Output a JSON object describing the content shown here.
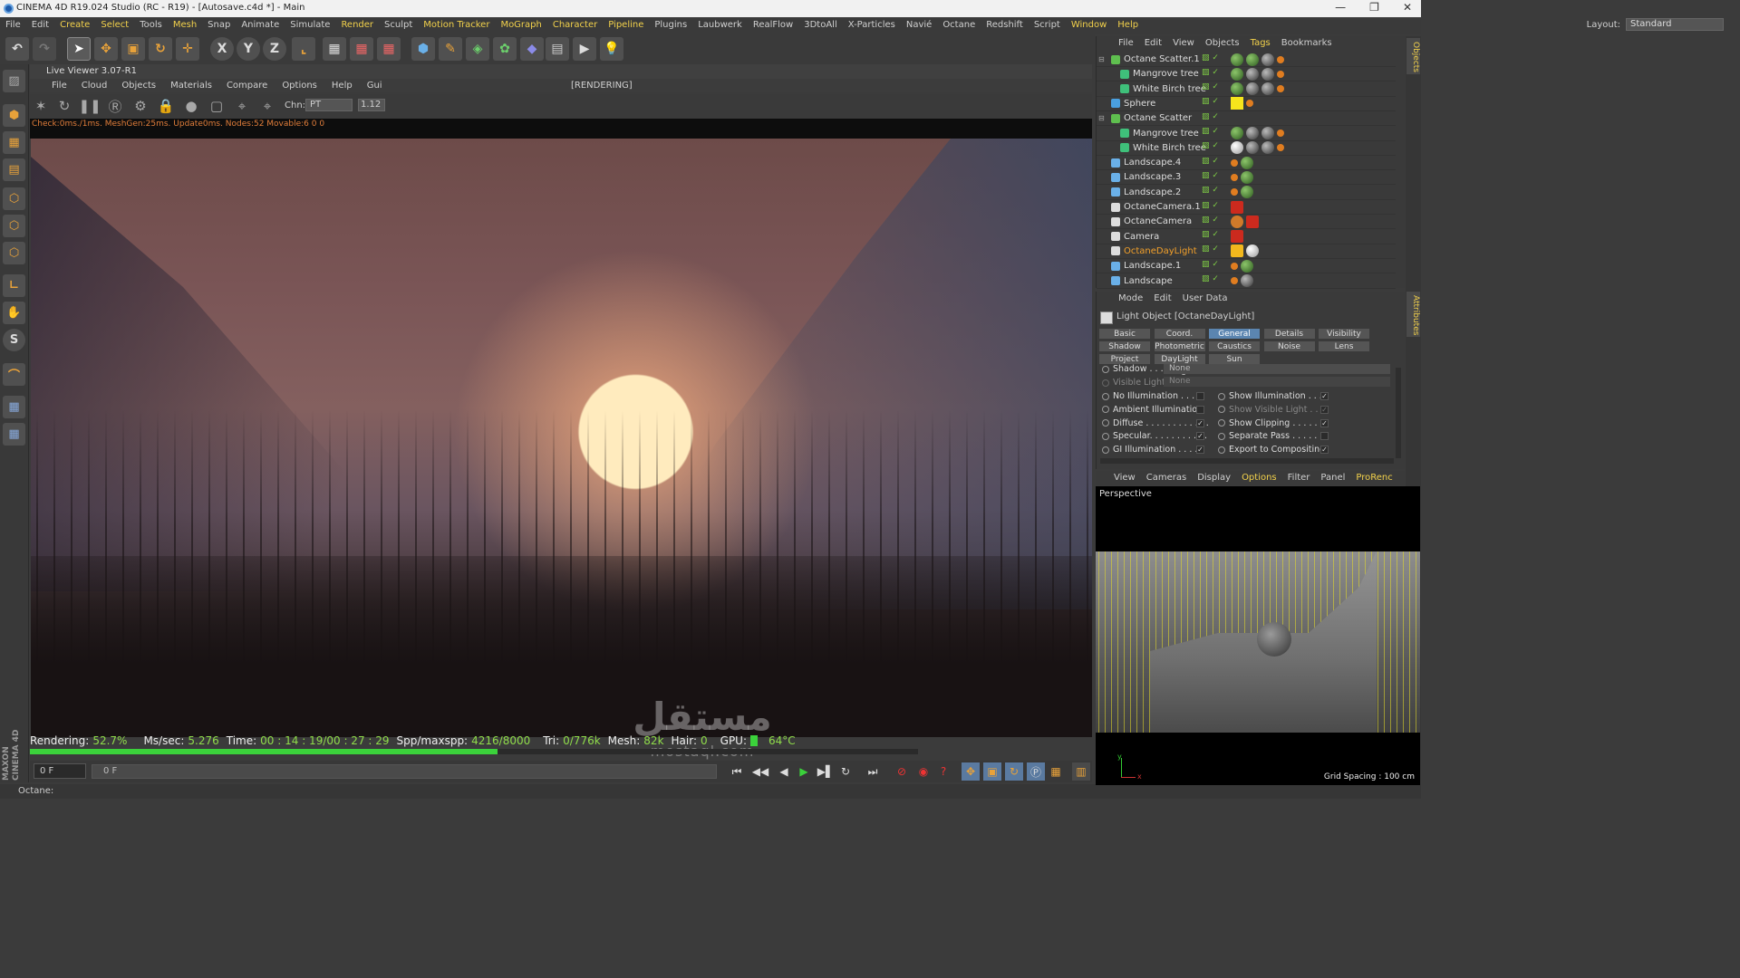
{
  "window": {
    "title": "CINEMA 4D R19.024 Studio (RC - R19) - [Autosave.c4d *] - Main",
    "controls": [
      "—",
      "❐",
      "✕"
    ]
  },
  "menubar": {
    "items": [
      {
        "label": "File",
        "hl": false
      },
      {
        "label": "Edit",
        "hl": false
      },
      {
        "label": "Create",
        "hl": true
      },
      {
        "label": "Select",
        "hl": true
      },
      {
        "label": "Tools",
        "hl": false
      },
      {
        "label": "Mesh",
        "hl": true
      },
      {
        "label": "Snap",
        "hl": false
      },
      {
        "label": "Animate",
        "hl": false
      },
      {
        "label": "Simulate",
        "hl": false
      },
      {
        "label": "Render",
        "hl": true
      },
      {
        "label": "Sculpt",
        "hl": false
      },
      {
        "label": "Motion Tracker",
        "hl": true
      },
      {
        "label": "MoGraph",
        "hl": true
      },
      {
        "label": "Character",
        "hl": true
      },
      {
        "label": "Pipeline",
        "hl": true
      },
      {
        "label": "Plugins",
        "hl": false
      },
      {
        "label": "Laubwerk",
        "hl": false
      },
      {
        "label": "RealFlow",
        "hl": false
      },
      {
        "label": "3DtoAll",
        "hl": false
      },
      {
        "label": "X-Particles",
        "hl": false
      },
      {
        "label": "Navié",
        "hl": false
      },
      {
        "label": "Octane",
        "hl": false
      },
      {
        "label": "Redshift",
        "hl": false
      },
      {
        "label": "Script",
        "hl": false
      },
      {
        "label": "Window",
        "hl": true
      },
      {
        "label": "Help",
        "hl": true
      }
    ],
    "layout_label": "Layout:",
    "layout_value": "Standard"
  },
  "toolbar": {
    "icons": [
      "undo-icon",
      "redo-icon",
      "select-arrow-icon",
      "move-icon",
      "scale-icon",
      "rotate-icon",
      "recent-tool-icon",
      "x-axis-lock-icon",
      "y-axis-lock-icon",
      "z-axis-lock-icon",
      "coordinate-system-icon",
      "render-view-icon",
      "render-picture-viewer-icon",
      "edit-render-settings-icon",
      "cube-primitive-icon",
      "pen-spline-icon",
      "subdivision-icon",
      "array-icon",
      "deformer-icon",
      "floor-icon",
      "camera-icon",
      "light-icon"
    ],
    "glyphs": {
      "x": "X",
      "y": "Y",
      "z": "Z"
    }
  },
  "live_viewer": {
    "title": "Live Viewer 3.07-R1",
    "menu": [
      "File",
      "Cloud",
      "Objects",
      "Materials",
      "Compare",
      "Options",
      "Help",
      "Gui"
    ],
    "status": "[RENDERING]",
    "channel_label": "Chn:",
    "channel_value": "PT",
    "zoom_value": "1.12",
    "info": "Check:0ms./1ms. MeshGen:25ms. Update0ms. Nodes:52 Movable:6  0 0"
  },
  "render_stats": {
    "rendering_label": "Rendering:",
    "rendering_value": "52.7%",
    "mssec_label": "Ms/sec:",
    "mssec_value": "5.276",
    "time_label": "Time:",
    "time_value": "00 : 14 : 19/00 : 27 : 29",
    "spp_label": "Spp/maxspp:",
    "spp_value": "4216/8000",
    "tri_label": "Tri:",
    "tri_value": "0/776k",
    "mesh_label": "Mesh:",
    "mesh_value": "82k",
    "hair_label": "Hair:",
    "hair_value": "0",
    "gpu_label": "GPU:",
    "gpu_temp": "64°C",
    "progress_fraction": 0.527
  },
  "watermark": {
    "arabic": "مستقل",
    "latin": "mostaql.com"
  },
  "timeline": {
    "frame_value": "0 F",
    "slider_value": "0 F",
    "controls": [
      "go-start-icon",
      "prev-key-icon",
      "prev-frame-icon",
      "play-icon",
      "next-frame-icon",
      "loop-icon",
      "go-end-icon",
      "record-icon",
      "autokey-icon",
      "keyframe-selection-icon"
    ]
  },
  "statusbar": {
    "text": "Octane:"
  },
  "side_brand": {
    "text": "MAXON CINEMA 4D"
  },
  "objects_panel": {
    "menu": [
      {
        "label": "File",
        "hl": false
      },
      {
        "label": "Edit",
        "hl": false
      },
      {
        "label": "View",
        "hl": false
      },
      {
        "label": "Objects",
        "hl": false
      },
      {
        "label": "Tags",
        "hl": true
      },
      {
        "label": "Bookmarks",
        "hl": false
      }
    ],
    "rows": [
      {
        "name": "Octane Scatter.1",
        "indent": 0,
        "icon_color": "#5fbf4f",
        "tags": [
          "g",
          "g",
          "d",
          "o"
        ]
      },
      {
        "name": "Mangrove tree",
        "indent": 1,
        "icon_color": "#3fc07a",
        "tags": [
          "g",
          "d",
          "d",
          "o"
        ]
      },
      {
        "name": "White Birch tree",
        "indent": 1,
        "icon_color": "#3fc07a",
        "tags": [
          "g",
          "d",
          "d",
          "o"
        ]
      },
      {
        "name": "Sphere",
        "indent": 0,
        "icon_color": "#4aa0e0",
        "tags": [
          "y",
          "o"
        ]
      },
      {
        "name": "Octane Scatter",
        "indent": 0,
        "icon_color": "#5fbf4f",
        "tags": []
      },
      {
        "name": "Mangrove tree",
        "indent": 1,
        "icon_color": "#3fc07a",
        "tags": [
          "g",
          "d",
          "d",
          "o"
        ]
      },
      {
        "name": "White Birch tree",
        "indent": 1,
        "icon_color": "#3fc07a",
        "tags": [
          "w",
          "d",
          "d",
          "o"
        ]
      },
      {
        "name": "Landscape.4",
        "indent": 0,
        "icon_color": "#6ab0e8",
        "tags": [
          "o",
          "g"
        ]
      },
      {
        "name": "Landscape.3",
        "indent": 0,
        "icon_color": "#6ab0e8",
        "tags": [
          "o",
          "g"
        ]
      },
      {
        "name": "Landscape.2",
        "indent": 0,
        "icon_color": "#6ab0e8",
        "tags": [
          "o",
          "g"
        ]
      },
      {
        "name": "OctaneCamera.1",
        "indent": 0,
        "icon_color": "#dddddd",
        "tags": [
          "r"
        ]
      },
      {
        "name": "OctaneCamera",
        "indent": 0,
        "icon_color": "#dddddd",
        "tags": [
          "x",
          "r"
        ]
      },
      {
        "name": "Camera",
        "indent": 0,
        "icon_color": "#dddddd",
        "tags": [
          "r"
        ]
      },
      {
        "name": "OctaneDayLight",
        "indent": 0,
        "icon_color": "#dddddd",
        "tags": [
          "s",
          "w"
        ],
        "selected": true
      },
      {
        "name": "Landscape.1",
        "indent": 0,
        "icon_color": "#6ab0e8",
        "tags": [
          "o",
          "g"
        ]
      },
      {
        "name": "Landscape",
        "indent": 0,
        "icon_color": "#6ab0e8",
        "tags": [
          "o",
          "d"
        ]
      }
    ]
  },
  "right_tabs": {
    "objects": "Objects",
    "attributes": "Attributes"
  },
  "attributes": {
    "menu": [
      "Mode",
      "Edit",
      "User Data"
    ],
    "title": "Light Object [OctaneDayLight]",
    "tabs_row1": [
      {
        "label": "Basic",
        "active": false
      },
      {
        "label": "Coord.",
        "active": false
      },
      {
        "label": "General",
        "active": true
      },
      {
        "label": "Details",
        "active": false
      },
      {
        "label": "Visibility",
        "active": false
      }
    ],
    "tabs_row2": [
      {
        "label": "Shadow",
        "active": false
      },
      {
        "label": "Photometric",
        "active": false
      },
      {
        "label": "Caustics",
        "active": false
      },
      {
        "label": "Noise",
        "active": false
      },
      {
        "label": "Lens",
        "active": false
      }
    ],
    "tabs_row3": [
      {
        "label": "Project",
        "active": false
      },
      {
        "label": "DayLight Tag",
        "active": false
      },
      {
        "label": "Sun",
        "active": false
      }
    ],
    "shadow_label": "Shadow . . .",
    "shadow_value": "None",
    "visible_light_label": "Visible Light",
    "visible_light_value": "None",
    "left_params": [
      {
        "label": "No Illumination . . . .",
        "checked": false
      },
      {
        "label": "Ambient Illumination",
        "checked": false
      },
      {
        "label": "Diffuse . . . . . . . . . . . .",
        "checked": true
      },
      {
        "label": "Specular. . . . . . . . . . .",
        "checked": true
      },
      {
        "label": "GI Illumination . . . . .",
        "checked": true
      }
    ],
    "right_params": [
      {
        "label": "Show Illumination . . .",
        "checked": true,
        "dim": false
      },
      {
        "label": "Show Visible Light . . .",
        "checked": true,
        "dim": true
      },
      {
        "label": "Show Clipping . . . . . .",
        "checked": true,
        "dim": false
      },
      {
        "label": "Separate Pass . . . . . .",
        "checked": false,
        "dim": false
      },
      {
        "label": "Export to Compositing",
        "checked": true,
        "dim": false
      }
    ]
  },
  "viewport": {
    "menu": [
      {
        "label": "View",
        "hl": false
      },
      {
        "label": "Cameras",
        "hl": false
      },
      {
        "label": "Display",
        "hl": false
      },
      {
        "label": "Options",
        "hl": true
      },
      {
        "label": "Filter",
        "hl": false
      },
      {
        "label": "Panel",
        "hl": false
      },
      {
        "label": "ProRenc",
        "hl": true
      }
    ],
    "label": "Perspective",
    "grid_spacing": "Grid Spacing : 100 cm",
    "axis_y": "y",
    "axis_x": "x"
  },
  "colors": {
    "accent_yellow": "#f2d14b",
    "progress_green": "#3bd23b",
    "selected_orange": "#f2a02a",
    "active_tab_blue": "#5b85b0"
  }
}
